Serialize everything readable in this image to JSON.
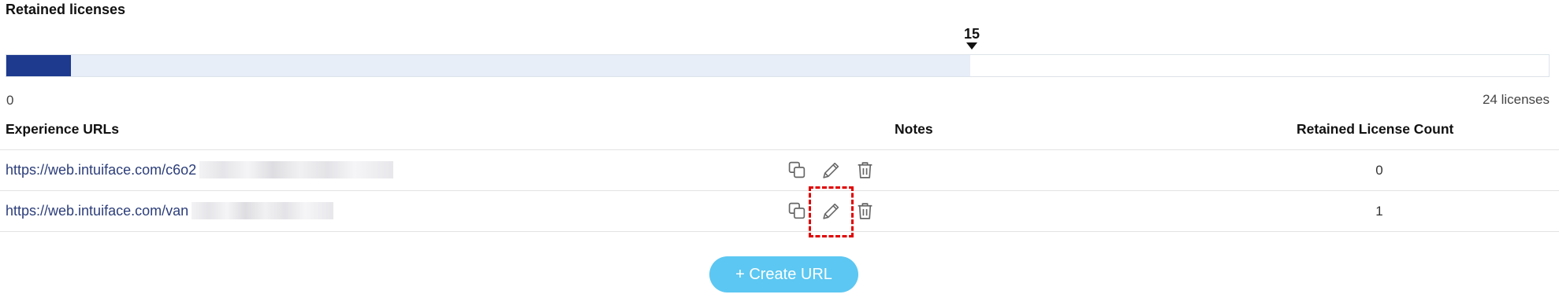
{
  "retained": {
    "title": "Retained licenses",
    "marker_value": "15",
    "scale_min": "0",
    "scale_max": "24 licenses",
    "used_fraction": 0.042,
    "retained_fraction": 0.625,
    "colors": {
      "used": "#1e3a8f",
      "retained": "#e8eef8"
    }
  },
  "table": {
    "headers": {
      "url": "Experience URLs",
      "notes": "Notes",
      "count": "Retained License Count"
    },
    "rows": [
      {
        "url": "https://web.intuiface.com/c6o2",
        "count": "0",
        "actions": [
          "copy-icon",
          "pencil-icon",
          "trash-icon"
        ]
      },
      {
        "url": "https://web.intuiface.com/van",
        "count": "1",
        "actions": [
          "copy-icon",
          "pencil-icon",
          "trash-icon"
        ]
      }
    ]
  },
  "create_button": {
    "label": "+ Create URL",
    "color": "#5cc7f2"
  }
}
